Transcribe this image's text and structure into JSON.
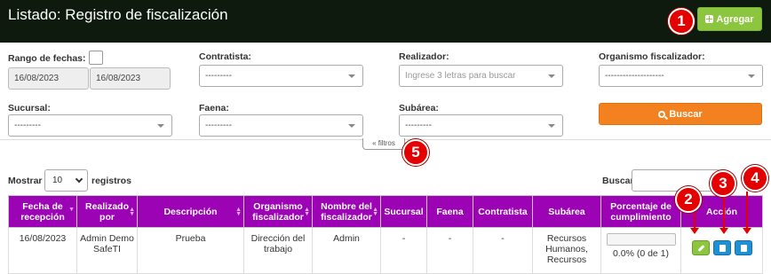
{
  "header": {
    "title": "Listado: Registro de fiscalización",
    "add_button": "Agregar"
  },
  "markers": [
    "1",
    "2",
    "3",
    "4",
    "5"
  ],
  "filters": {
    "rango_label": "Rango de fechas:",
    "date_from": "16/08/2023",
    "date_to": "16/08/2023",
    "contratista_label": "Contratista:",
    "contratista_value": "---------",
    "realizador_label": "Realizador:",
    "realizador_placeholder": "Ingrese 3 letras para buscar",
    "organismo_label": "Organismo fiscalizador:",
    "organismo_value": "--------------------",
    "sucursal_label": "Sucursal:",
    "sucursal_value": "---------",
    "faena_label": "Faena:",
    "faena_value": "---------",
    "subarea_label": "Subárea:",
    "subarea_value": "---------",
    "search_button": "Buscar",
    "filtros_toggle": "« filtros"
  },
  "table_controls": {
    "mostrar": "Mostrar",
    "page_length": "10",
    "registros": "registros",
    "buscar": "Buscar:"
  },
  "table": {
    "headers": [
      "Fecha de recepción",
      "Realizado por",
      "Descripción",
      "Organismo fiscalizador",
      "Nombre del fiscalizador",
      "Sucursal",
      "Faena",
      "Contratista",
      "Subárea",
      "Porcentaje de cumplimiento",
      "Acción"
    ],
    "rows": [
      {
        "fecha": "16/08/2023",
        "realizado": "Admin Demo SafeTI",
        "descripcion": "Prueba",
        "organismo": "Dirección del trabajo",
        "nombre": "Admin",
        "sucursal": "-",
        "faena": "-",
        "contratista": "-",
        "subarea": "Recursos Humanos, Recursos",
        "progress": 0,
        "porcentaje": "0.0% (0 de 1)"
      }
    ]
  },
  "colors": {
    "header_bg": "#0d1a0d",
    "table_header": "#9c03b4",
    "green": "#8cc63f",
    "orange": "#f4811f",
    "blue": "#1e90d6",
    "marker_red": "#e40000"
  },
  "icons": [
    "plus-icon",
    "search-icon",
    "edit-icon",
    "document-icon",
    "download-icon",
    "caret-down-icon"
  ]
}
